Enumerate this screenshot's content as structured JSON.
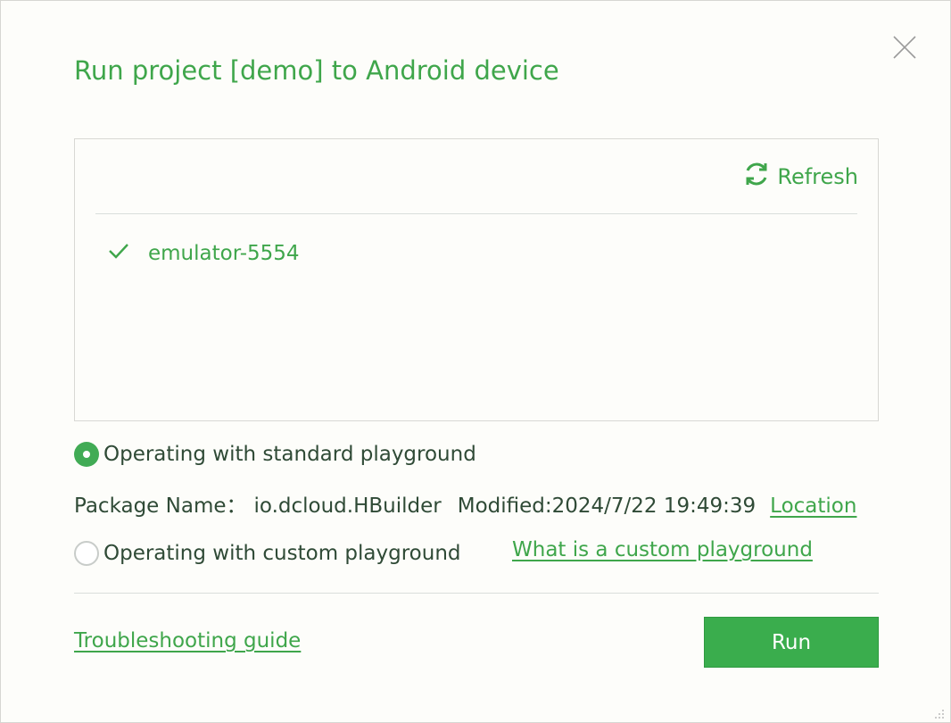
{
  "dialog": {
    "title": "Run project [demo] to Android device",
    "close_icon": "close-icon"
  },
  "devices": {
    "refresh_label": "Refresh",
    "refresh_icon": "refresh-icon",
    "items": [
      {
        "name": "emulator-5554",
        "selected": true,
        "icon": "checkmark-icon"
      }
    ]
  },
  "playground": {
    "standard_label": "Operating with standard playground",
    "standard_selected": true,
    "package_name_label": "Package Name：",
    "package_name_value": "io.dcloud.HBuilder",
    "modified_label": "Modified:",
    "modified_value": "2024/7/22 19:49:39",
    "location_link": "Location",
    "custom_label": "Operating with custom playground",
    "custom_selected": false,
    "custom_help_link": "What is a custom playground"
  },
  "footer": {
    "troubleshooting_link": "Troubleshooting guide",
    "run_label": "Run"
  },
  "colors": {
    "accent": "#3fa64b",
    "button": "#3aad4d",
    "text": "#2f4a36",
    "background": "#fdfdfa"
  }
}
